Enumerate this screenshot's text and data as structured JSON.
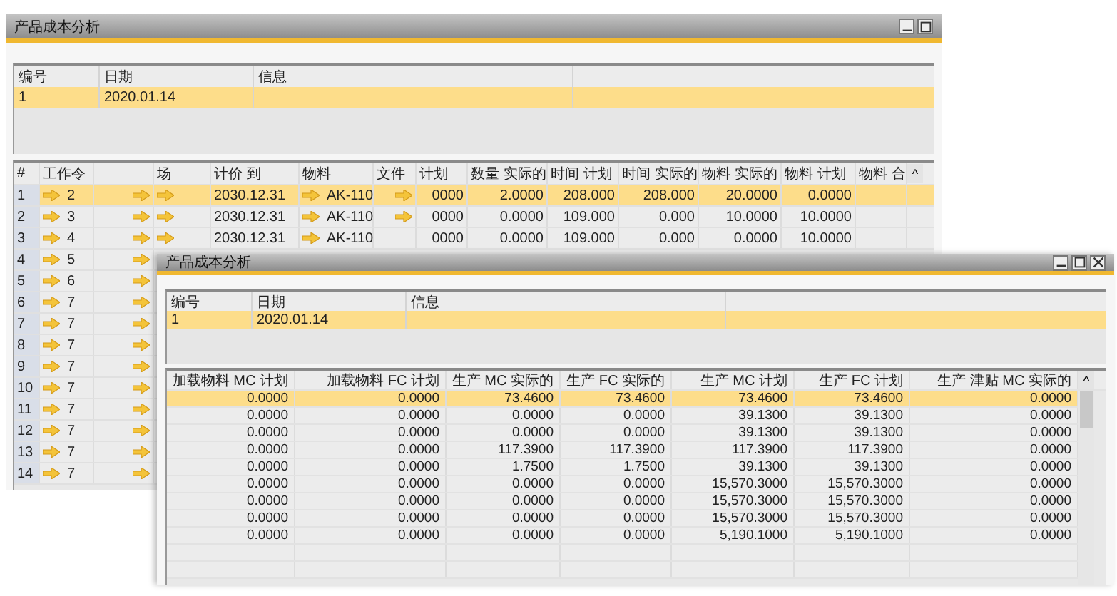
{
  "back_window": {
    "title": "产品成本分析",
    "header_table": {
      "columns": [
        "编号",
        "日期",
        "信息"
      ],
      "rows": [
        {
          "number": "1",
          "date": "2020.01.14",
          "selected": true
        }
      ]
    },
    "detail_table": {
      "columns": [
        {
          "kind": "text",
          "label": "#"
        },
        {
          "kind": "text",
          "label": "工作令"
        },
        {
          "kind": "blank"
        },
        {
          "kind": "text",
          "label": "场"
        },
        {
          "kind": "text",
          "label": "计价 到"
        },
        {
          "kind": "text",
          "label": "物料"
        },
        {
          "kind": "text",
          "label": "文件"
        },
        {
          "kind": "text",
          "label": "计划"
        },
        {
          "kind": "text",
          "label": "数量 实际的"
        },
        {
          "kind": "text",
          "label": "时间 计划"
        },
        {
          "kind": "text",
          "label": "时间 实际的"
        },
        {
          "kind": "text",
          "label": "物料 实际的"
        },
        {
          "kind": "text",
          "label": "物料 计划"
        },
        {
          "kind": "text",
          "label": "物料 合"
        }
      ],
      "scroll_up": "^",
      "rows": [
        {
          "num": "1",
          "selected": true,
          "work_order": "2",
          "due_date": "2030.12.31",
          "item": "AK-110",
          "file_link": true,
          "plan": "0000",
          "qty_actual": "2.0000",
          "time_plan": "208.000",
          "time_actual": "208.000",
          "item_actual": "20.0000",
          "item_plan": "0.0000"
        },
        {
          "num": "2",
          "selected": false,
          "work_order": "3",
          "due_date": "2030.12.31",
          "item": "AK-110",
          "file_link": true,
          "plan": "0000",
          "qty_actual": "0.0000",
          "time_plan": "109.000",
          "time_actual": "0.000",
          "item_actual": "10.0000",
          "item_plan": "10.0000"
        },
        {
          "num": "3",
          "selected": false,
          "work_order": "4",
          "due_date": "2030.12.31",
          "item": "AK-110",
          "file_link": false,
          "plan": "0000",
          "qty_actual": "0.0000",
          "time_plan": "109.000",
          "time_actual": "0.000",
          "item_actual": "0.0000",
          "item_plan": "10.0000"
        },
        {
          "num": "4",
          "selected": false,
          "work_order": "5"
        },
        {
          "num": "5",
          "selected": false,
          "work_order": "6"
        },
        {
          "num": "6",
          "selected": false,
          "work_order": "7"
        },
        {
          "num": "7",
          "selected": false,
          "work_order": "7"
        },
        {
          "num": "8",
          "selected": false,
          "work_order": "7"
        },
        {
          "num": "9",
          "selected": false,
          "work_order": "7"
        },
        {
          "num": "10",
          "selected": false,
          "work_order": "7"
        },
        {
          "num": "11",
          "selected": false,
          "work_order": "7"
        },
        {
          "num": "12",
          "selected": false,
          "work_order": "7"
        },
        {
          "num": "13",
          "selected": false,
          "work_order": "7"
        },
        {
          "num": "14",
          "selected": false,
          "work_order": "7"
        }
      ]
    }
  },
  "front_window": {
    "title": "产品成本分析",
    "header_table": {
      "columns": [
        "编号",
        "日期",
        "信息"
      ],
      "rows": [
        {
          "number": "1",
          "date": "2020.01.14",
          "selected": true
        }
      ]
    },
    "detail_table": {
      "columns": [
        "加载物料 MC 计划",
        "加载物料 FC 计划",
        "生产 MC 实际的",
        "生产 FC 实际的",
        "生产 MC 计划",
        "生产 FC 计划",
        "生产 津贴 MC 实际的"
      ],
      "scroll_up": "^",
      "rows": [
        {
          "selected": true,
          "cells": [
            "0.0000",
            "0.0000",
            "73.4600",
            "73.4600",
            "73.4600",
            "73.4600",
            "0.0000"
          ]
        },
        {
          "selected": false,
          "cells": [
            "0.0000",
            "0.0000",
            "0.0000",
            "0.0000",
            "39.1300",
            "39.1300",
            "0.0000"
          ]
        },
        {
          "selected": false,
          "cells": [
            "0.0000",
            "0.0000",
            "0.0000",
            "0.0000",
            "39.1300",
            "39.1300",
            "0.0000"
          ]
        },
        {
          "selected": false,
          "cells": [
            "0.0000",
            "0.0000",
            "117.3900",
            "117.3900",
            "117.3900",
            "117.3900",
            "0.0000"
          ]
        },
        {
          "selected": false,
          "cells": [
            "0.0000",
            "0.0000",
            "1.7500",
            "1.7500",
            "39.1300",
            "39.1300",
            "0.0000"
          ]
        },
        {
          "selected": false,
          "cells": [
            "0.0000",
            "0.0000",
            "0.0000",
            "0.0000",
            "15,570.3000",
            "15,570.3000",
            "0.0000"
          ]
        },
        {
          "selected": false,
          "cells": [
            "0.0000",
            "0.0000",
            "0.0000",
            "0.0000",
            "15,570.3000",
            "15,570.3000",
            "0.0000"
          ]
        },
        {
          "selected": false,
          "cells": [
            "0.0000",
            "0.0000",
            "0.0000",
            "0.0000",
            "15,570.3000",
            "15,570.3000",
            "0.0000"
          ]
        },
        {
          "selected": false,
          "cells": [
            "0.0000",
            "0.0000",
            "0.0000",
            "0.0000",
            "5,190.1000",
            "5,190.1000",
            "0.0000"
          ]
        }
      ]
    }
  }
}
